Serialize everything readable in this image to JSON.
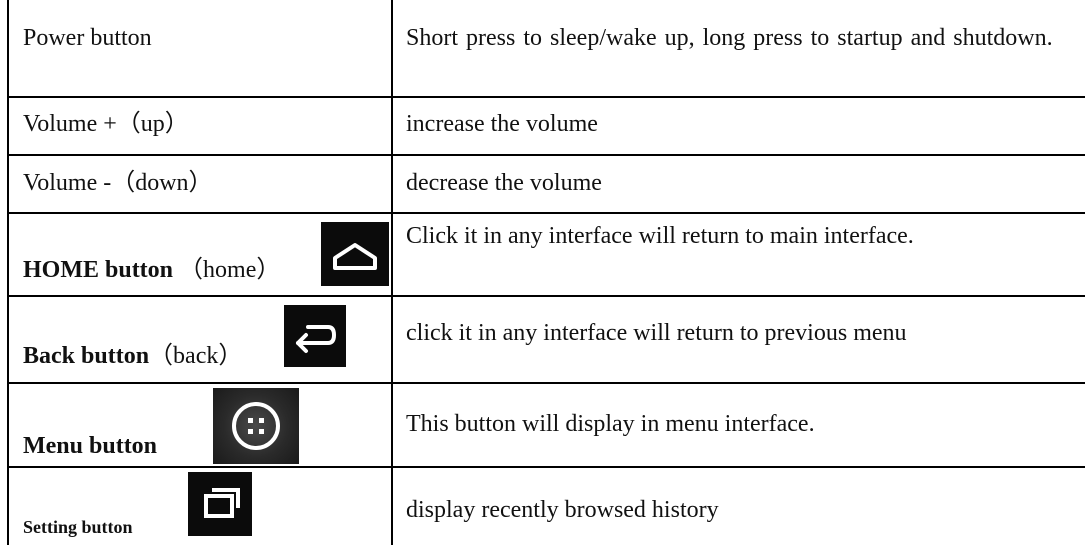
{
  "rows": [
    {
      "label": "Power button",
      "description": "Short press to sleep/wake up, long press to startup and shutdown."
    },
    {
      "label": "Volume +（up）",
      "description": "increase the volume"
    },
    {
      "label": "Volume -（down）",
      "description": "decrease the volume"
    },
    {
      "label_bold": "HOME button",
      "label_suffix": "（home）",
      "icon": "home-icon",
      "description": "Click it in any interface will return to main interface."
    },
    {
      "label_bold": "Back button",
      "label_suffix": "（back）",
      "icon": "back-arrow-icon",
      "description": "click it in any interface will return to previous menu"
    },
    {
      "label_bold": "Menu button",
      "icon": "menu-grid-icon",
      "description": "This button will display in menu interface."
    },
    {
      "label_bold": "Setting button",
      "icon": "recent-apps-icon",
      "description": "display recently browsed history"
    }
  ],
  "colors": {
    "border": "#000000",
    "text": "#111111",
    "icon_bg": "#0b0b0b",
    "icon_fg": "#ffffff"
  }
}
